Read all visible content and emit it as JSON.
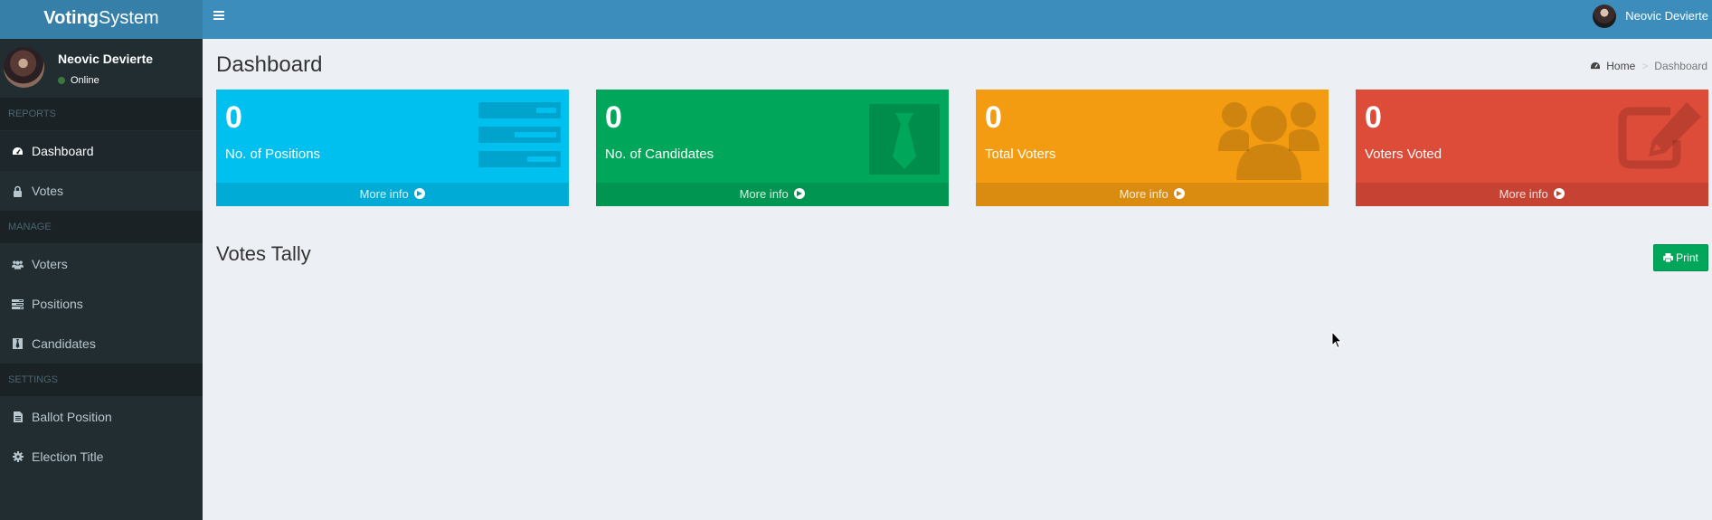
{
  "header": {
    "brand_bold": "Voting",
    "brand_light": "System",
    "user_name": "Neovic Devierte"
  },
  "sidebar": {
    "user": {
      "name": "Neovic Devierte",
      "status": "Online"
    },
    "sections": {
      "reports": "REPORTS",
      "manage": "MANAGE",
      "settings": "SETTINGS"
    },
    "items": [
      {
        "label": "Dashboard",
        "icon": "dashboard-icon",
        "active": true
      },
      {
        "label": "Votes",
        "icon": "lock-icon"
      },
      {
        "label": "Voters",
        "icon": "users-icon"
      },
      {
        "label": "Positions",
        "icon": "tasks-icon"
      },
      {
        "label": "Candidates",
        "icon": "black-tie-icon"
      },
      {
        "label": "Ballot Position",
        "icon": "file-text-icon"
      },
      {
        "label": "Election Title",
        "icon": "cog-icon"
      }
    ]
  },
  "main": {
    "title": "Dashboard",
    "breadcrumb": {
      "home": "Home",
      "current": "Dashboard"
    },
    "cards": [
      {
        "value": "0",
        "label": "No. of Positions",
        "footer": "More info",
        "color": "#00c0ef",
        "icon": "tasks-icon"
      },
      {
        "value": "0",
        "label": "No. of Candidates",
        "footer": "More info",
        "color": "#00a65a",
        "icon": "black-tie-icon"
      },
      {
        "value": "0",
        "label": "Total Voters",
        "footer": "More info",
        "color": "#f39c12",
        "icon": "users-icon"
      },
      {
        "value": "0",
        "label": "Voters Voted",
        "footer": "More info",
        "color": "#dd4b39",
        "icon": "edit-icon"
      }
    ],
    "tally_title": "Votes Tally",
    "print_label": "Print"
  }
}
